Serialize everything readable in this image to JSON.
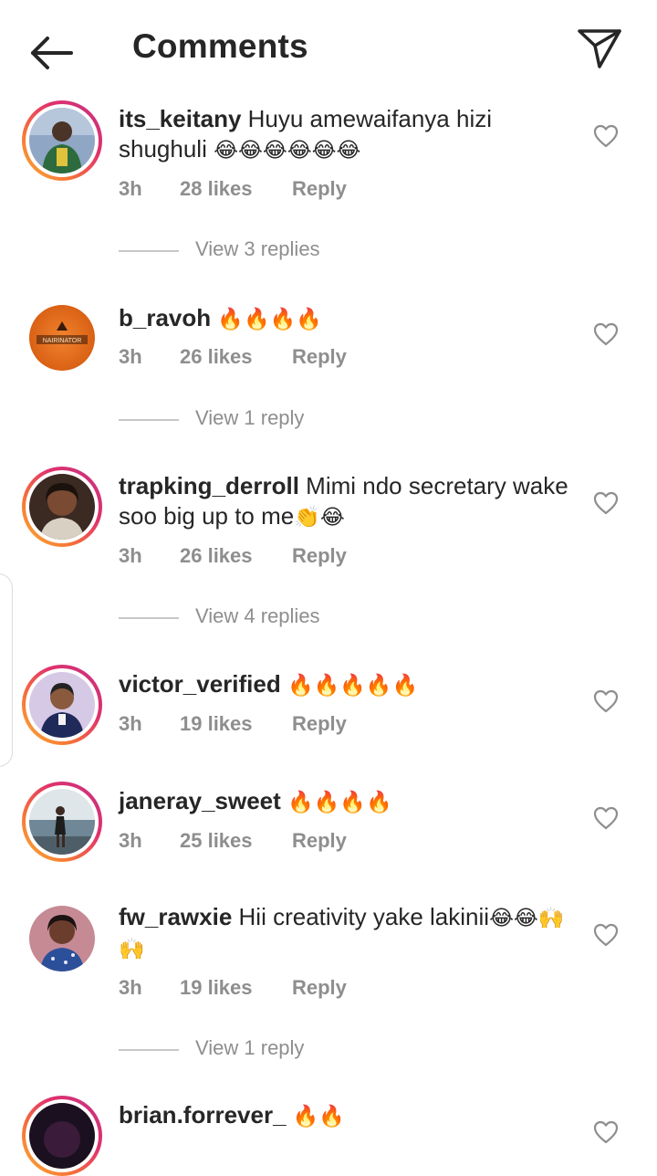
{
  "header": {
    "title": "Comments",
    "back_icon": "arrow-left-icon",
    "share_icon": "paper-plane-icon"
  },
  "colors": {
    "text": "#262626",
    "secondary": "#8e8e8e",
    "divider": "#c7c7c7",
    "story_ring": [
      "#f9b233",
      "#f77737",
      "#e1306c",
      "#c13584"
    ]
  },
  "comments": [
    {
      "username": "its_keitany",
      "text": "Huyu amewaifanya hizi shughuli",
      "emojis": "😂😂😂😂😂😂",
      "time": "3h",
      "likes": "28 likes",
      "reply": "Reply",
      "view_replies": "View 3 replies",
      "has_story": true
    },
    {
      "username": "b_ravoh",
      "text": "",
      "emojis": "🔥🔥🔥🔥",
      "time": "3h",
      "likes": "26 likes",
      "reply": "Reply",
      "view_replies": "View 1 reply",
      "has_story": false,
      "avatar_text": "NAIRINATOR"
    },
    {
      "username": "trapking_derroll",
      "text": "Mimi ndo secretary wake soo big up to me",
      "emojis": "👏😂",
      "time": "3h",
      "likes": "26 likes",
      "reply": "Reply",
      "view_replies": "View 4 replies",
      "has_story": true
    },
    {
      "username": "victor_verified",
      "text": "",
      "emojis": "🔥🔥🔥🔥🔥",
      "time": "3h",
      "likes": "19 likes",
      "reply": "Reply",
      "has_story": true
    },
    {
      "username": "janeray_sweet",
      "text": "",
      "emojis": "🔥🔥🔥🔥",
      "time": "3h",
      "likes": "25 likes",
      "reply": "Reply",
      "has_story": true
    },
    {
      "username": "fw_rawxie",
      "text": "Hii creativity yake lakinii",
      "emojis": "😂😂🙌🙌",
      "time": "3h",
      "likes": "19 likes",
      "reply": "Reply",
      "view_replies": "View 1 reply",
      "has_story": false
    },
    {
      "username": "brian.forrever_",
      "text": "",
      "emojis": "🔥🔥",
      "has_story": true
    }
  ]
}
